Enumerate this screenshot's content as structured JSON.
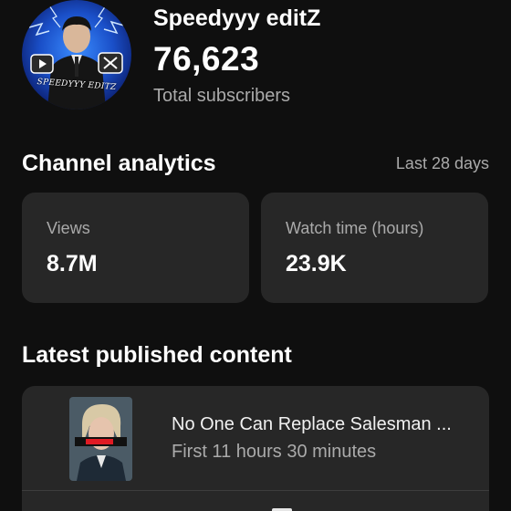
{
  "channel": {
    "name": "Speedyyy editZ",
    "subscribers": "76,623",
    "subscribers_label": "Total subscribers",
    "avatar_text": "SPEEDYYY EDITZ"
  },
  "analytics": {
    "title": "Channel analytics",
    "period": "Last 28 days",
    "metrics": [
      {
        "label": "Views",
        "value": "8.7M"
      },
      {
        "label": "Watch time (hours)",
        "value": "23.9K"
      }
    ]
  },
  "latest": {
    "title": "Latest published content",
    "items": [
      {
        "title": "No One Can Replace Salesman ...",
        "meta": "First 11 hours 30 minutes"
      }
    ]
  },
  "colors": {
    "background": "#0f0f0f",
    "card": "#272727",
    "text_primary": "#ffffff",
    "text_secondary": "#aaaaaa"
  }
}
